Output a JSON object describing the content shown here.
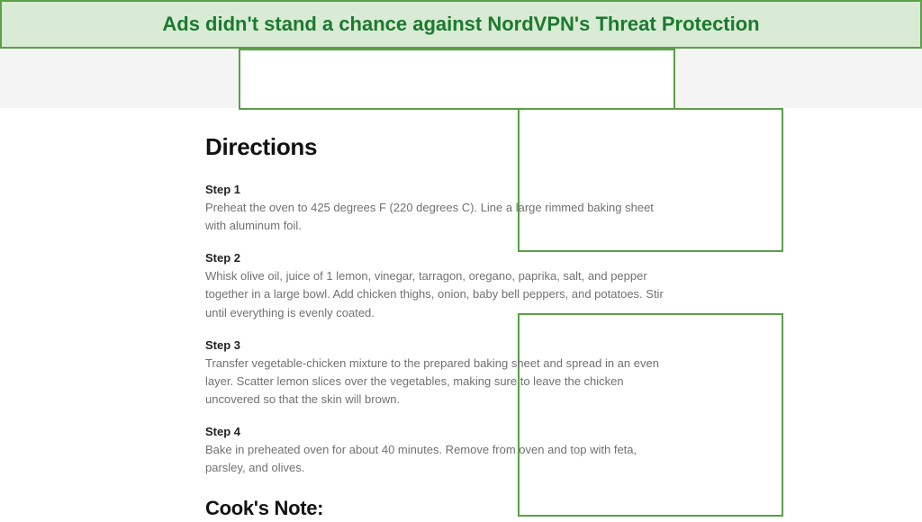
{
  "banner": {
    "headline": "Ads didn't stand a chance against NordVPN's Threat Protection"
  },
  "colors": {
    "accent_green": "#5aa046",
    "banner_bg": "#d9ebd4",
    "banner_text": "#1b7a2f",
    "toolbar_bg": "#f4f4f4",
    "body_text": "#717171",
    "heading_text": "#121212"
  },
  "ad_placeholders": [
    {
      "position": "top-banner"
    },
    {
      "position": "sidebar-upper"
    },
    {
      "position": "sidebar-lower"
    }
  ],
  "article": {
    "section_heading": "Directions",
    "steps": [
      {
        "label": "Step 1",
        "text": "Preheat the oven to 425 degrees F (220 degrees C). Line a large rimmed baking sheet with aluminum foil."
      },
      {
        "label": "Step 2",
        "text": "Whisk olive oil, juice of 1 lemon, vinegar, tarragon, oregano, paprika, salt, and pepper together in a large bowl. Add chicken thighs, onion, baby bell peppers, and potatoes. Stir until everything is evenly coated."
      },
      {
        "label": "Step 3",
        "text": "Transfer vegetable-chicken mixture to the prepared baking sheet and spread in an even layer. Scatter lemon slices over the vegetables, making sure to leave the chicken uncovered so that the skin will brown."
      },
      {
        "label": "Step 4",
        "text": "Bake in preheated oven for about 40 minutes. Remove from oven and top with feta, parsley, and olives."
      }
    ],
    "note_heading": "Cook's Note:"
  }
}
